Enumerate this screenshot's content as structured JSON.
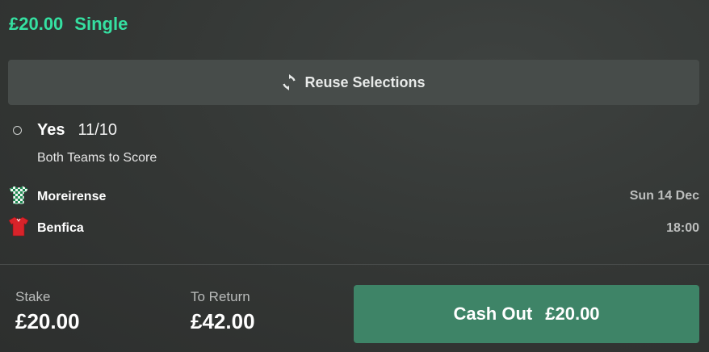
{
  "bet": {
    "amount": "£20.00",
    "type": "Single"
  },
  "reuse": {
    "label": "Reuse Selections",
    "icon": "refresh-icon"
  },
  "selection": {
    "name": "Yes",
    "odds": "11/10",
    "market": "Both Teams to Score"
  },
  "event": {
    "home": {
      "name": "Moreirense",
      "icon": "kit-green-white-checkered-icon"
    },
    "away": {
      "name": "Benfica",
      "icon": "kit-red-icon"
    },
    "date": "Sun 14 Dec",
    "time": "18:00"
  },
  "footer": {
    "stake_label": "Stake",
    "stake_value": "£20.00",
    "return_label": "To Return",
    "return_value": "£42.00",
    "cashout_label": "Cash Out",
    "cashout_value": "£20.00"
  },
  "colors": {
    "accent": "#35e0a1",
    "cashout_bg": "#3e8467",
    "button_bg": "#474c4a"
  }
}
